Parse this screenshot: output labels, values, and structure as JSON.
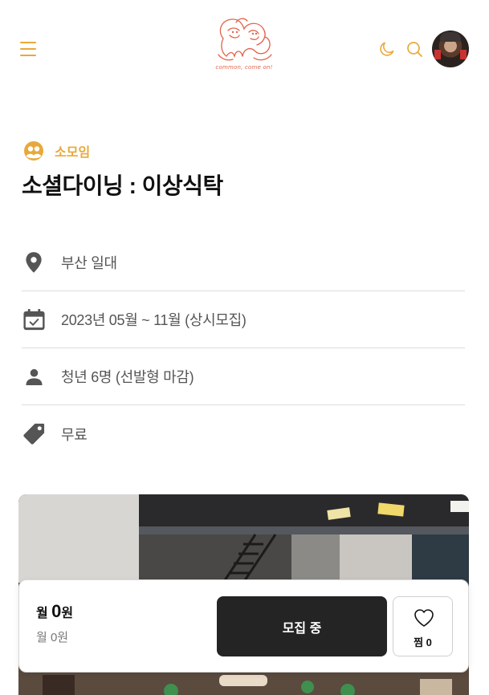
{
  "header": {
    "logo_text": "common, come on!",
    "menu_icon": "hamburger-menu-icon",
    "theme_icon": "moon-icon",
    "search_icon": "search-icon"
  },
  "category": {
    "icon": "group-icon",
    "label": "소모임"
  },
  "title": "소셜다이닝 : 이상식탁",
  "info": [
    {
      "icon": "location-pin-icon",
      "text": "부산 일대"
    },
    {
      "icon": "calendar-icon",
      "text": "2023년 05월 ~ 11월 (상시모집)"
    },
    {
      "icon": "person-icon",
      "text": "청년 6명 (선발형 마감)"
    },
    {
      "icon": "price-tag-icon",
      "text": "무료"
    }
  ],
  "bottom_bar": {
    "price_prefix": "월 ",
    "price_value": "0",
    "price_unit": "원",
    "price_sub": "월 0원",
    "status_label": "모집 중",
    "like_label": "찜 0"
  },
  "colors": {
    "accent": "#e8a93a",
    "logo": "#e2624a",
    "dark_button": "#242424"
  }
}
